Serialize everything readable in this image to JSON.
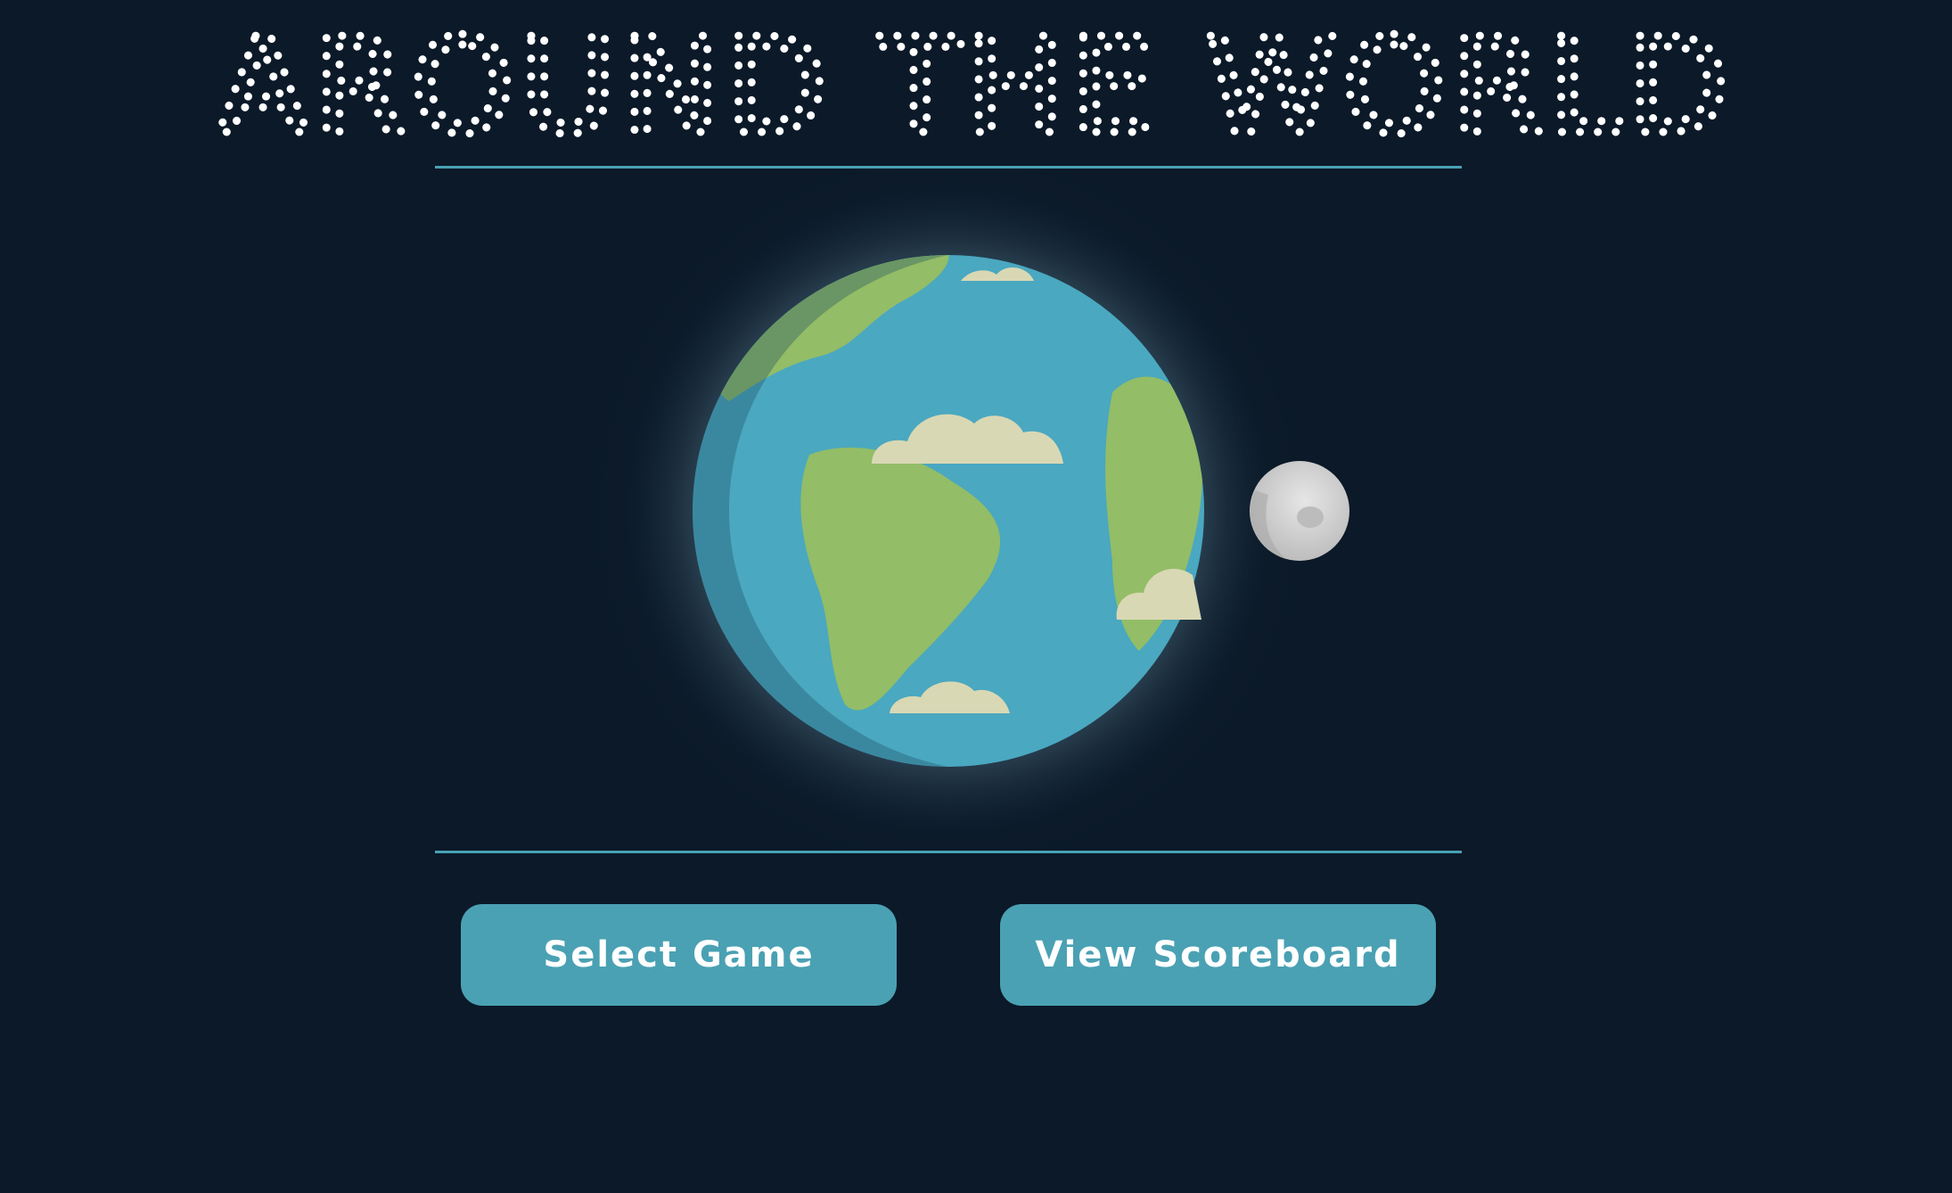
{
  "title": "AROUND THE WORLD",
  "buttons": {
    "select_game": "Select Game",
    "view_scoreboard": "View Scoreboard"
  },
  "icons": {
    "planet": "earth-icon",
    "satellite": "moon-icon"
  },
  "colors": {
    "background": "#0b1928",
    "accent": "#4aa1b3",
    "ocean": "#4aa8c0",
    "land": "#93bd66",
    "cloud": "#d9d8b4",
    "moon": "#d2d2d2",
    "title": "#ffffff"
  }
}
